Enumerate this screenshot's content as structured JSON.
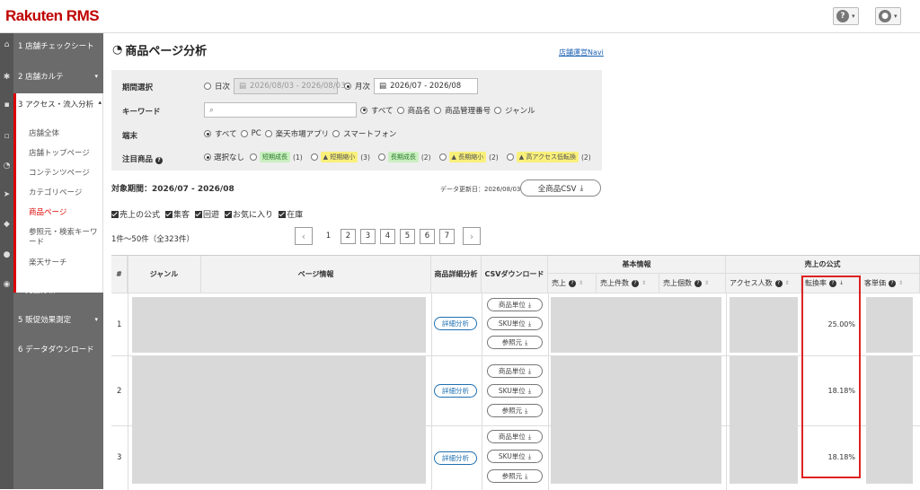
{
  "header": {
    "logo": "Rakuten RMS",
    "help_icon": "?",
    "user_icon": "user"
  },
  "sidebar": {
    "items": [
      {
        "label": "1 店舗チェックシート"
      },
      {
        "label": "2 店舗カルテ"
      },
      {
        "label": "3 アクセス・流入分析"
      },
      {
        "label": "4 売上分析"
      },
      {
        "label": "5 販促効果測定"
      },
      {
        "label": "6 データダウンロード"
      }
    ],
    "subitems": [
      {
        "label": "店舗全体"
      },
      {
        "label": "店舗トップページ"
      },
      {
        "label": "コンテンツページ"
      },
      {
        "label": "カテゴリページ"
      },
      {
        "label": "商品ページ"
      },
      {
        "label": "参照元・検索キーワード"
      },
      {
        "label": "楽天サーチ"
      }
    ]
  },
  "page": {
    "title": "商品ページ分析",
    "navi_link": "店舗運営Navi"
  },
  "filters": {
    "period_label": "期間選択",
    "daily_label": "日次",
    "daily_range": "2026/08/03 - 2026/08/03",
    "monthly_label": "月次",
    "monthly_range": "2026/07 - 2026/08",
    "keyword_label": "キーワード",
    "keyword_placeholder": "",
    "kw_opt_all": "すべて",
    "kw_opt_name": "商品名",
    "kw_opt_code": "商品管理番号",
    "kw_opt_genre": "ジャンル",
    "device_label": "端末",
    "dev_all": "すべて",
    "dev_pc": "PC",
    "dev_app": "楽天市場アプリ",
    "dev_sp": "スマートフォン",
    "focus_label": "注目商品",
    "focus_none": "選択なし",
    "focus_opts": [
      {
        "label": "短期成長",
        "count": "(1)"
      },
      {
        "label": "短期縮小",
        "count": "(3)"
      },
      {
        "label": "長期成長",
        "count": "(2)"
      },
      {
        "label": "長期縮小",
        "count": "(2)"
      },
      {
        "label": "高アクセス低転換",
        "count": "(2)"
      }
    ]
  },
  "summary": {
    "period": "対象期間：2026/07 - 2026/08",
    "updated": "データ更新日：2026/08/03",
    "csv_all": "全商品CSV",
    "checks": [
      "売上の公式",
      "集客",
      "回遊",
      "お気に入り",
      "在庫"
    ],
    "count": "1件～50件（全323件）",
    "pages": [
      "1",
      "2",
      "3",
      "4",
      "5",
      "6",
      "7"
    ]
  },
  "table": {
    "h_no": "#",
    "h_genre": "ジャンル",
    "h_page": "ページ情報",
    "h_detail": "商品詳細分析",
    "h_csv": "CSVダウンロード",
    "h_basic": "基本情報",
    "h_formula": "売上の公式",
    "cols": [
      "売上",
      "売上件数",
      "売上個数",
      "アクセス人数",
      "転換率",
      "客単価"
    ],
    "detail_btn": "詳細分析",
    "csv_btns": [
      "商品単位",
      "SKU単位",
      "参照元"
    ],
    "rows": [
      {
        "no": "1",
        "cvr": "25.00%"
      },
      {
        "no": "2",
        "cvr": "18.18%"
      },
      {
        "no": "3",
        "cvr": "18.18%"
      }
    ]
  }
}
